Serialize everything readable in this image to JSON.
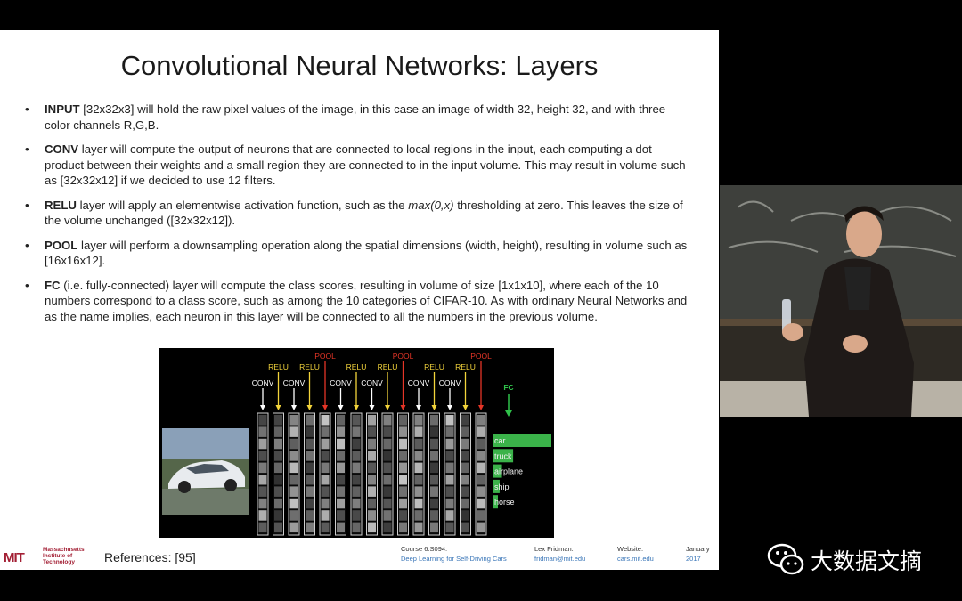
{
  "slide": {
    "title": "Convolutional Neural Networks: Layers",
    "bullets": [
      {
        "term": "INPUT",
        "text": " [32x32x3] will hold the raw pixel values of the image, in this case an image of width 32, height 32, and with three color channels R,G,B."
      },
      {
        "term": "CONV",
        "text": " layer will compute the output of neurons that are connected to local regions in the input, each computing a dot product between their weights and a small region they are connected to in the input volume. This may result in volume such as [32x32x12] if we decided to use 12 filters."
      },
      {
        "term": "RELU",
        "text_before": " layer will apply an elementwise activation function, such as the ",
        "italic": "max(0,x)",
        "text_after": " thresholding at zero. This leaves the size of the volume unchanged ([32x32x12])."
      },
      {
        "term": "POOL",
        "text": " layer will perform a downsampling operation along the spatial dimensions (width, height), resulting in volume such as [16x16x12]."
      },
      {
        "term": "FC",
        "text": " (i.e. fully-connected) layer will compute the class scores, resulting in volume of size [1x1x10], where each of the 10 numbers correspond to a class score, such as among the 10 categories of CIFAR-10. As with ordinary Neural Networks and as the name implies, each neuron in this layer will be connected to all the numbers in the previous volume."
      }
    ]
  },
  "diagram": {
    "layers": [
      "CONV",
      "RELU",
      "CONV",
      "RELU",
      "POOL",
      "CONV",
      "RELU",
      "CONV",
      "RELU",
      "POOL",
      "CONV",
      "RELU",
      "CONV",
      "RELU",
      "POOL"
    ],
    "fc_label": "FC",
    "classes": [
      {
        "label": "car",
        "score": 1.0
      },
      {
        "label": "truck",
        "score": 0.35
      },
      {
        "label": "airplane",
        "score": 0.16
      },
      {
        "label": "ship",
        "score": 0.12
      },
      {
        "label": "horse",
        "score": 0.08
      }
    ],
    "colors": {
      "conv": "#ffffff",
      "relu": "#f3d43b",
      "pool": "#e53527",
      "fc": "#2fc24a",
      "bar": "#3bb34a"
    }
  },
  "footer": {
    "logo_lines": [
      "Massachusetts",
      "Institute of",
      "Technology"
    ],
    "logo_mark": "MIT",
    "references": "References: [95]",
    "course_line1": "Course 6.S094:",
    "course_line2": "Deep Learning for Self-Driving Cars",
    "author_line1": "Lex Fridman:",
    "author_line2": "fridman@mit.edu",
    "website_line1": "Website:",
    "website_line2": "cars.mit.edu",
    "date_line1": "January",
    "date_line2": "2017"
  },
  "watermark": {
    "text": "大数据文摘",
    "icon": "wechat-icon"
  }
}
